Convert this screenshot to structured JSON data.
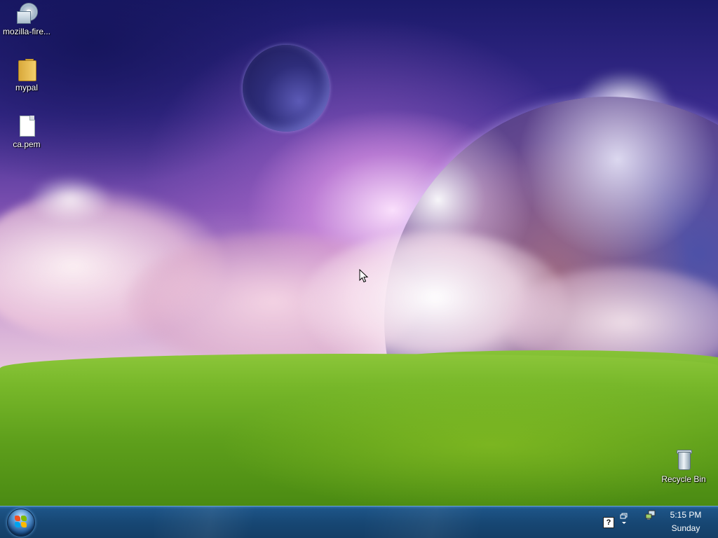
{
  "desktop": {
    "icons": [
      {
        "label": "mozilla-fire...",
        "icon": "installer-icon"
      },
      {
        "label": "mypal",
        "icon": "folder-icon"
      },
      {
        "label": "ca.pem",
        "icon": "file-icon"
      },
      {
        "label": "Recycle Bin",
        "icon": "recycle-bin-icon"
      }
    ]
  },
  "taskbar": {
    "start_icon": "windows-flag-icon",
    "tray": {
      "help_glyph": "?",
      "restore_icon": "restore-window-icon",
      "network_icon": "network-icon"
    },
    "clock": {
      "time": "5:15 PM",
      "day": "Sunday"
    }
  },
  "colors": {
    "taskbar": "#174774",
    "grass": "#78b82a",
    "sky": "#3a2b8e"
  }
}
